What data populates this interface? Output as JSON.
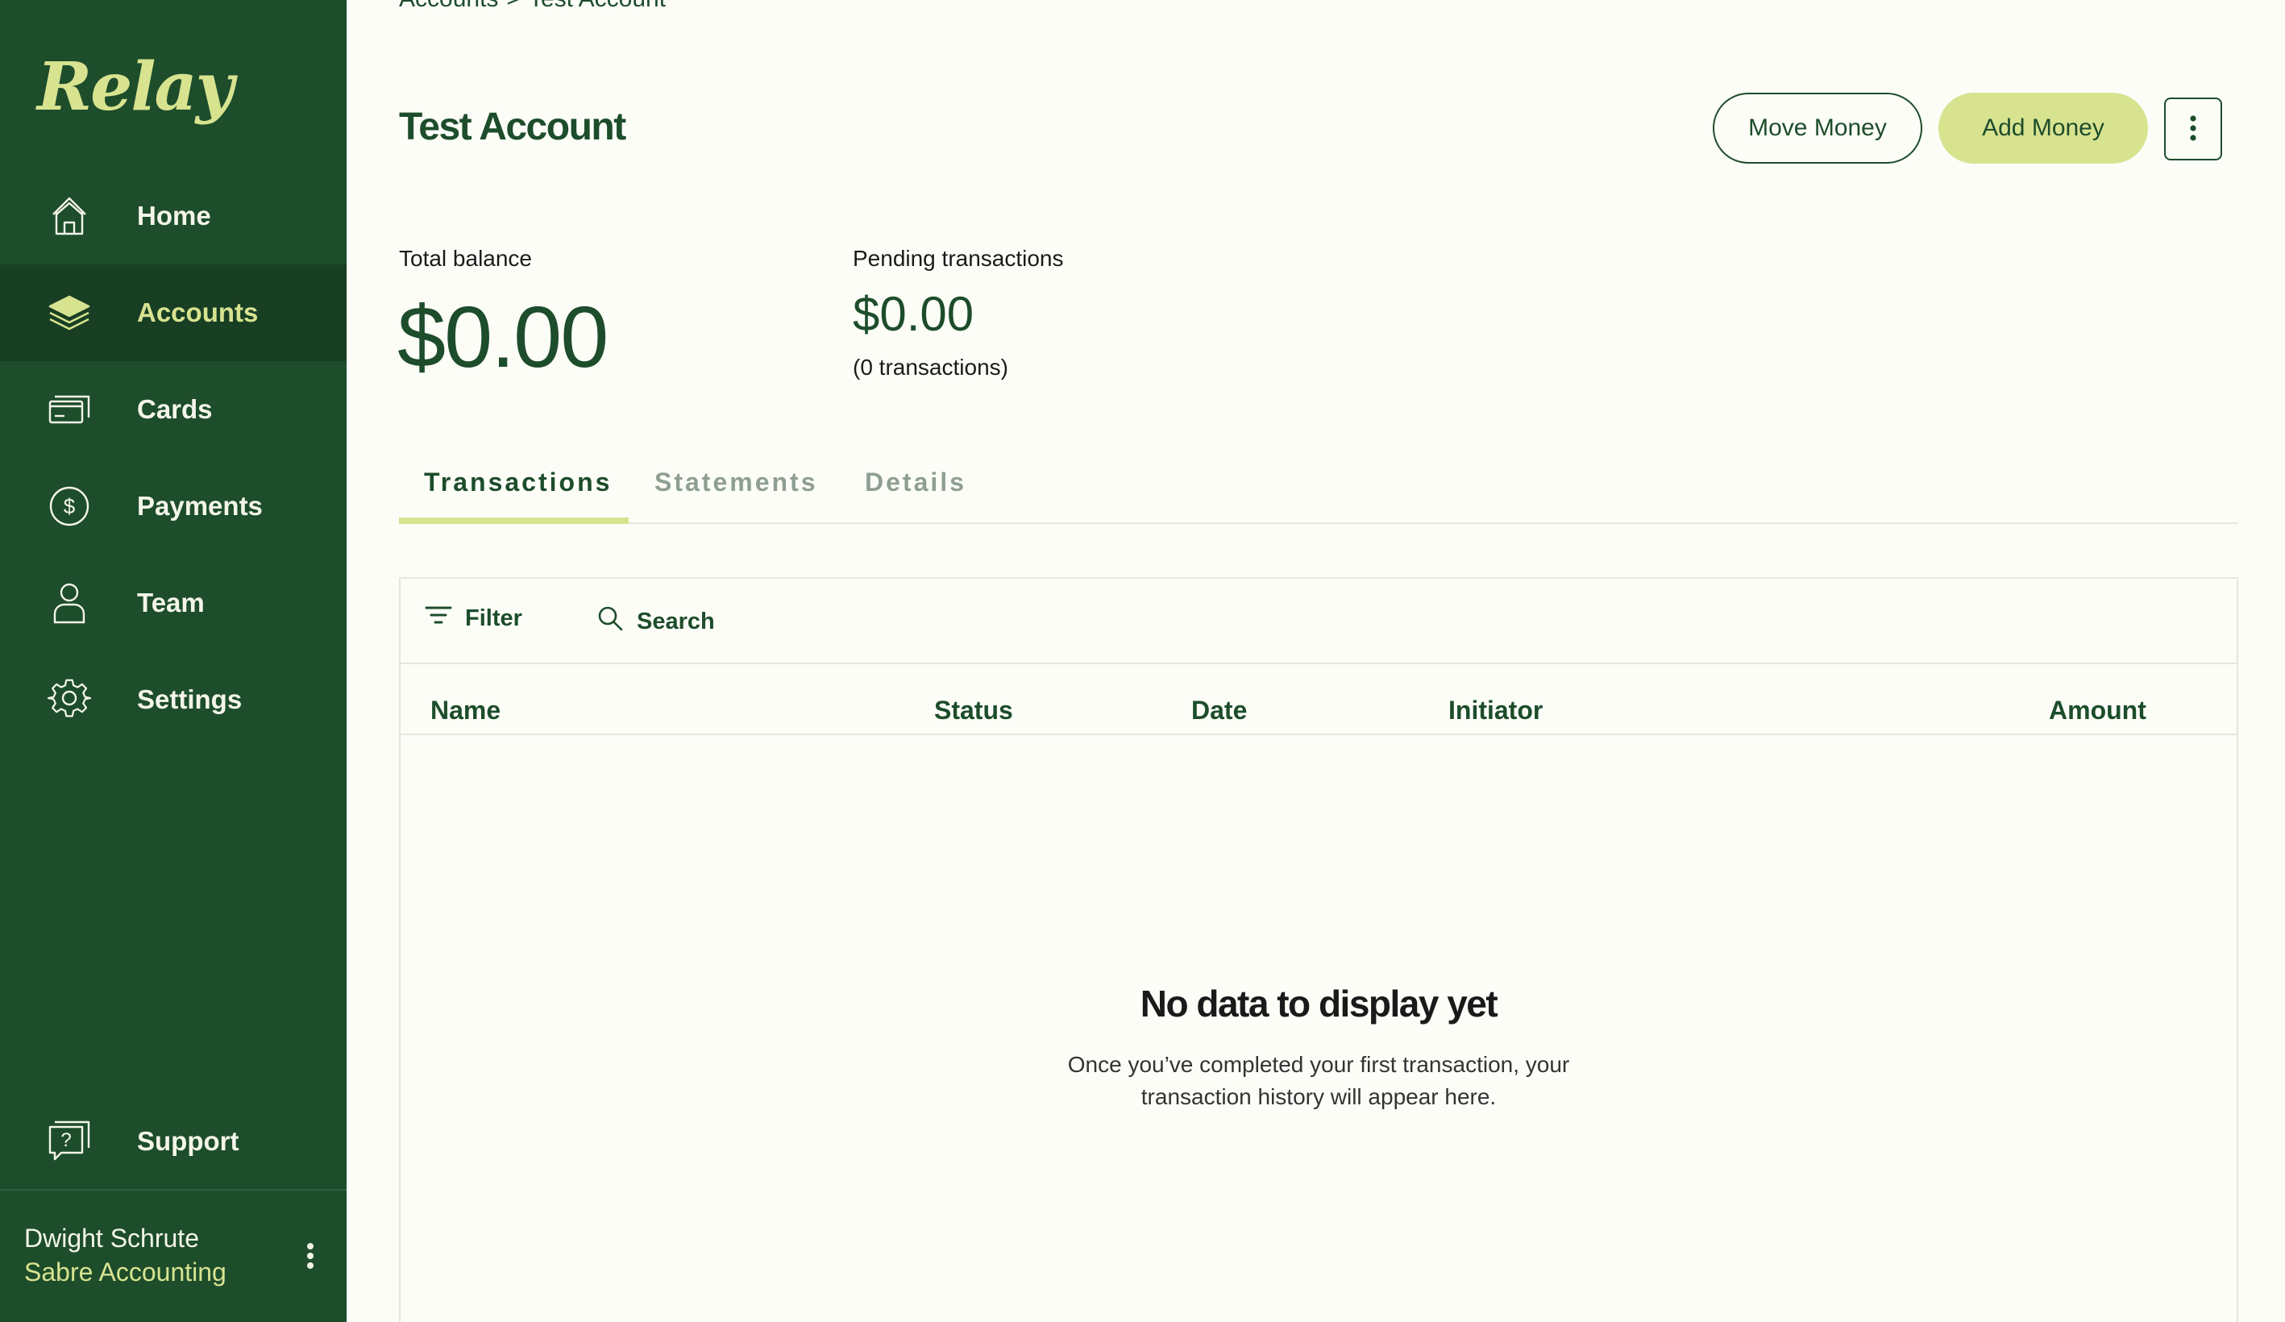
{
  "app": {
    "logo": "Relay"
  },
  "sidebar": {
    "items": [
      {
        "label": "Home",
        "icon": "home-icon",
        "active": false
      },
      {
        "label": "Accounts",
        "icon": "layers-icon",
        "active": true
      },
      {
        "label": "Cards",
        "icon": "cards-icon",
        "active": false
      },
      {
        "label": "Payments",
        "icon": "dollar-circle-icon",
        "active": false
      },
      {
        "label": "Team",
        "icon": "person-icon",
        "active": false
      },
      {
        "label": "Settings",
        "icon": "gear-icon",
        "active": false
      }
    ],
    "support": {
      "label": "Support",
      "icon": "help-icon"
    },
    "user": {
      "name": "Dwight Schrute",
      "org": "Sabre Accounting"
    }
  },
  "breadcrumb": {
    "parent": "Accounts",
    "separator": ">",
    "current": "Test Account"
  },
  "header": {
    "title": "Test Account",
    "move_money": "Move Money",
    "add_money": "Add Money"
  },
  "balances": {
    "total_label": "Total balance",
    "total_value": "$0.00",
    "pending_label": "Pending transactions",
    "pending_value": "$0.00",
    "pending_count": "(0 transactions)"
  },
  "tabs": [
    {
      "label": "Transactions",
      "active": true
    },
    {
      "label": "Statements",
      "active": false
    },
    {
      "label": "Details",
      "active": false
    }
  ],
  "toolbar": {
    "filter": "Filter",
    "search": "Search"
  },
  "table": {
    "columns": [
      "Name",
      "Status",
      "Date",
      "Initiator",
      "Amount"
    ]
  },
  "empty_state": {
    "title": "No data to display yet",
    "line1": "Once you’ve completed your first transaction, your",
    "line2": "transaction history will appear here."
  },
  "colors": {
    "sidebar": "#1d4d2b",
    "accent": "#d8e390",
    "text_dark_green": "#1d4d2b",
    "background": "#fdfdf8"
  }
}
